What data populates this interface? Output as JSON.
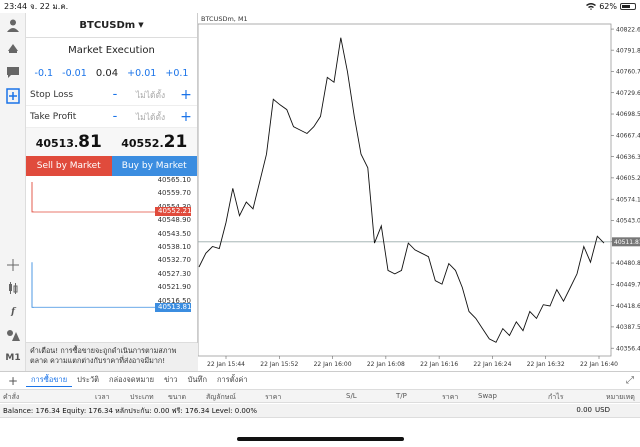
{
  "status": {
    "time": "23:44",
    "date": "จ. 22 ม.ค.",
    "battery": "62%"
  },
  "order": {
    "symbol": "BTCUSDm",
    "execution": "Market Execution",
    "volume": {
      "minus_big": "-0.1",
      "minus_small": "-0.01",
      "value": "0.04",
      "plus_small": "+0.01",
      "plus_big": "+0.1"
    },
    "stop_loss": {
      "label": "Stop Loss",
      "value": "ไม่ได้ตั้ง",
      "minus": "-",
      "plus": "+"
    },
    "take_profit": {
      "label": "Take Profit",
      "value": "ไม่ได้ตั้ง",
      "minus": "-",
      "plus": "+"
    },
    "bid": {
      "main": "40513.",
      "big": "81"
    },
    "ask": {
      "main": "40552.",
      "big": "21"
    },
    "sell_label": "Sell by Market",
    "buy_label": "Buy by Market",
    "mini_ticks": [
      "40565.10",
      "40559.70",
      "40554.30",
      "40548.90",
      "40543.50",
      "40538.10",
      "40532.70",
      "40527.30",
      "40521.90",
      "40516.50"
    ],
    "ask_tag": "40552.21",
    "bid_tag": "40513.81",
    "warning": "คำเตือน! การซื้อขายจะถูกดำเนินการตามสภาพตลาด ความแตกต่างกับราคาที่ส่งอาจมีมาก!"
  },
  "chart": {
    "title": "BTCUSDm, M1",
    "price_tag": "40511.81",
    "chart_data": {
      "type": "line",
      "title": "BTCUSDm, M1",
      "x_ticks": [
        "22 Jan 15:44",
        "22 Jan 15:52",
        "22 Jan 16:00",
        "22 Jan 16:08",
        "22 Jan 16:16",
        "22 Jan 16:24",
        "22 Jan 16:32",
        "22 Jan 16:40"
      ],
      "y_ticks": [
        "40822.60",
        "40791.80",
        "40760.70",
        "40729.60",
        "40698.50",
        "40667.40",
        "40636.30",
        "40605.20",
        "40574.10",
        "40543.00",
        "40511.81",
        "40480.80",
        "40449.70",
        "40418.60",
        "40387.50",
        "40356.40"
      ],
      "ylim": [
        40345,
        40830
      ],
      "current_price": 40511.81,
      "series": [
        {
          "values": [
            40475,
            40495,
            40505,
            40502,
            40540,
            40590,
            40550,
            40570,
            40560,
            40600,
            40640,
            40720,
            40712,
            40705,
            40680,
            40675,
            40670,
            40680,
            40695,
            40752,
            40745,
            40810,
            40760,
            40695,
            40640,
            40620,
            40510,
            40535,
            40470,
            40465,
            40470,
            40510,
            40500,
            40495,
            40490,
            40455,
            40450,
            40480,
            40470,
            40445,
            40410,
            40400,
            40385,
            40370,
            40365,
            40385,
            40375,
            40395,
            40382,
            40410,
            40400,
            40420,
            40418,
            40442,
            40425,
            40445,
            40465,
            40505,
            40482,
            40520,
            40510
          ]
        }
      ]
    }
  },
  "tabs": {
    "plus": "+",
    "items": [
      "การซื้อขาย",
      "ประวัติ",
      "กล่องจดหมาย",
      "ข่าว",
      "บันทึก",
      "การตั้งค่า"
    ],
    "active": 0
  },
  "columns": [
    "คำสั่ง",
    "เวลา",
    "ประเภท",
    "ขนาด",
    "สัญลักษณ์",
    "ราคา",
    "S/L",
    "T/P",
    "ราคา",
    "Swap",
    "กำไร",
    "หมายเหตุ"
  ],
  "balance": {
    "text": "Balance: 176.34 Equity: 176.34 หลักประกัน: 0.00 ฟรี: 176.34 Level: 0.00%",
    "profit": "0.00",
    "currency": "USD"
  }
}
